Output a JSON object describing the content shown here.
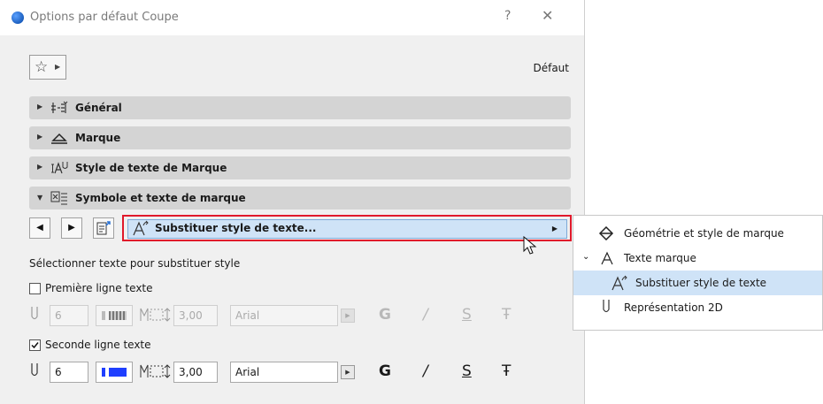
{
  "window": {
    "title": "Options par défaut Coupe",
    "help_label": "?",
    "close_label": "✕"
  },
  "toolbar": {
    "favorites_icon": "star-icon",
    "default_label": "Défaut"
  },
  "sections": [
    {
      "label": "Général",
      "expanded": false,
      "icon": "general-settings-icon"
    },
    {
      "label": "Marque",
      "expanded": false,
      "icon": "marker-icon"
    },
    {
      "label": "Style de texte de Marque",
      "expanded": false,
      "icon": "text-style-icon"
    },
    {
      "label": "Symbole et texte de marque",
      "expanded": true,
      "icon": "symbol-text-icon"
    }
  ],
  "panel": {
    "selector_label": "Substituer style de texte...",
    "instruction": "Sélectionner texte pour substituer style",
    "line1": {
      "label": "Première ligne texte",
      "checked": false,
      "pen": "6",
      "height": "3,00",
      "font": "Arial",
      "bold": "G",
      "italic": "/",
      "underline": "S",
      "strike": "Ŧ"
    },
    "line2": {
      "label": "Seconde ligne texte",
      "checked": true,
      "pen": "6",
      "pen_color": "#1f3fff",
      "height": "3,00",
      "font": "Arial",
      "bold": "G",
      "italic": "/",
      "underline": "S",
      "strike": "Ŧ"
    }
  },
  "menu": {
    "items": [
      {
        "label": "Géométrie et style de marque",
        "icon": "marker-geometry-icon",
        "selected": false
      },
      {
        "label": "Texte marque",
        "icon": "text-a-icon",
        "selected": false,
        "expanded": true
      },
      {
        "label": "Substituer style de texte",
        "icon": "override-text-style-icon",
        "selected": true
      },
      {
        "label": "Représentation 2D",
        "icon": "pen-icon",
        "selected": false
      }
    ]
  },
  "colors": {
    "highlight": "#cfe3f7",
    "red_outline": "#e0192b",
    "section_bg": "#d4d4d4"
  }
}
